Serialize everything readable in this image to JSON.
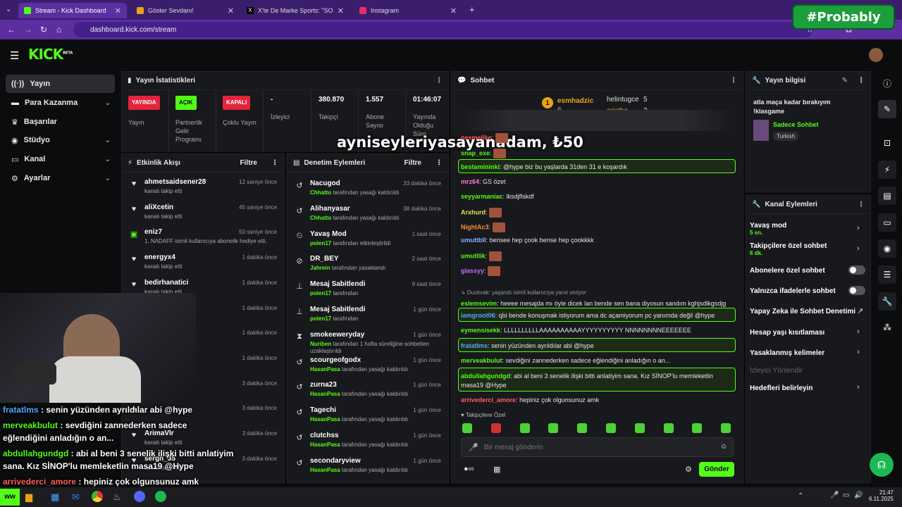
{
  "browser": {
    "tabs": [
      {
        "title": "Stream - Kick Dashboard",
        "color": "#53fc18"
      },
      {
        "title": "Göster Sevdanı!",
        "color": "#e8a317"
      },
      {
        "title": "X'te De Marke Sports: \"SON DA",
        "color": "#000000"
      },
      {
        "title": "Instagram",
        "color": "#e1306c"
      }
    ],
    "url": "dashboard.kick.com/stream",
    "overlay": "#Probably"
  },
  "header": {
    "logo": "KICK",
    "beta": "BETA"
  },
  "sidebar": {
    "items": [
      {
        "label": "Yayın",
        "icon": "stream-icon"
      },
      {
        "label": "Para Kazanma",
        "icon": "money-icon"
      },
      {
        "label": "Başarılar",
        "icon": "trophy-icon"
      },
      {
        "label": "Stüdyo",
        "icon": "studio-icon"
      },
      {
        "label": "Kanal",
        "icon": "channel-icon"
      },
      {
        "label": "Ayarlar",
        "icon": "gear-icon"
      }
    ]
  },
  "stats": {
    "title": "Yayın İstatistikleri",
    "items": [
      {
        "badge": "YAYINDA",
        "label": "Yayın"
      },
      {
        "badge": "AÇIK",
        "label": "Partnerlik Gelir Programı"
      },
      {
        "badge": "KAPALI",
        "label": "Çoklu Yayın"
      },
      {
        "value": "-",
        "label": "İzleyici"
      },
      {
        "value": "380.870",
        "label": "Takipçi"
      },
      {
        "value": "1.557",
        "label": "Abone Sayısı"
      },
      {
        "value": "01:46:07",
        "label": "Yayında Olduğu Süre"
      }
    ]
  },
  "activity": {
    "title": "Etkinlik Akışı",
    "filter": "Filtre",
    "rows": [
      {
        "name": "ahmetsaidsener28",
        "desc": "kanalı takip etti",
        "time": "12 saniye önce"
      },
      {
        "name": "aliXcetin",
        "desc": "kanalı takip etti",
        "time": "45 saniye önce"
      },
      {
        "name": "eniz7",
        "desc": "1, NADAFF isimli kullanıcıya abonelik hediye etti.",
        "time": "50 saniye önce"
      },
      {
        "name": "energyx4",
        "desc": "kanalı takip etti",
        "time": "1 dakika önce"
      },
      {
        "name": "bedirhanatici",
        "desc": "kanalı takip etti",
        "time": "1 dakika önce"
      },
      {
        "time": "1 dakika önce"
      },
      {
        "time": "1 dakika önce"
      },
      {
        "time": "1 dakika önce"
      },
      {
        "time": "3 dakika önce"
      },
      {
        "time": "3 dakika önce"
      },
      {
        "name": "ArimaVlr",
        "desc": "kanalı takip etti",
        "time": "3 dakika önce"
      },
      {
        "name": "sergn_35",
        "desc": "kanalı takip etti",
        "time": "3 dakika önce"
      }
    ]
  },
  "moderation": {
    "title": "Denetim Eylemleri",
    "filter": "Filtre",
    "rows": [
      {
        "name": "Nacugod",
        "by": "Chhatto",
        "desc": "tarafından yasağı kaldırıldı",
        "time": "33 dakika önce"
      },
      {
        "name": "Alihanyasar",
        "by": "Chhatto",
        "desc": "tarafından yasağı kaldırıldı",
        "time": "38 dakika önce"
      },
      {
        "name": "Yavaş Mod",
        "by": "polen17",
        "desc": "tarafından etkinleştirildi",
        "time": "1 saat önce"
      },
      {
        "name": "DR_BEY",
        "by": "Jahrein",
        "desc": "tarafından yasaklandı",
        "time": "2 saat önce"
      },
      {
        "name": "Mesaj Sabitlendi",
        "by": "polen17",
        "desc": "tarafından",
        "time": "9 saat önce"
      },
      {
        "name": "Mesaj Sabitlendi",
        "by": "polen17",
        "desc": "tarafından",
        "time": "1 gün önce"
      },
      {
        "name": "smokeeweryday",
        "by": "Nuriben",
        "desc": "tarafından 1 hafta süreliğine sohbetten uzaklaştırıldı",
        "time": "1 gün önce"
      },
      {
        "name": "scourgeofgodx",
        "by": "HasanPasa",
        "desc": "tarafından yasağı kaldırıldı",
        "time": "1 gün önce"
      },
      {
        "name": "zurna23",
        "by": "HasanPasa",
        "desc": "tarafından yasağı kaldırıldı",
        "time": "1 gün önce"
      },
      {
        "name": "Tagechi",
        "by": "HasanPasa",
        "desc": "tarafından yasağı kaldırıldı",
        "time": "1 gün önce"
      },
      {
        "name": "clutchss",
        "by": "HasanPasa",
        "desc": "tarafından yasağı kaldırıldı",
        "time": "1 gün önce"
      },
      {
        "name": "secondaryview",
        "by": "HasanPasa",
        "desc": "tarafından yasağı kaldırıldı",
        "time": "1 gün önce"
      }
    ]
  },
  "chat": {
    "title": "Sohbet",
    "top": [
      {
        "name": "esmhadzic",
        "count": "6"
      },
      {
        "name": "helintugce",
        "count": "5"
      },
      {
        "name": "aristha",
        "count": "2"
      }
    ],
    "donation": "ayniseyleriyasayanadam, ₺50",
    "messages": [
      {
        "user": "nesmelike",
        "color": "#ff5c5c",
        "text": ""
      },
      {
        "user": "snap_exe",
        "color": "#53fc18",
        "text": ""
      },
      {
        "user": "bestamininki",
        "color": "#53fc18",
        "text": "@hype biz bu yaşlarda 31den 31 e koşardık"
      },
      {
        "user": "mrz64",
        "color": "#ff7ad1",
        "text": "GS özet"
      },
      {
        "user": "seyyarmaniac",
        "color": "#53fc18",
        "text": "lksdjflskdf"
      },
      {
        "user": "Arxhurd",
        "color": "#e8e35a",
        "text": ""
      },
      {
        "user": "NightAc3",
        "color": "#ff8c3a",
        "text": ""
      },
      {
        "user": "umuttbll",
        "color": "#8ab4ff",
        "text": "bensee hep çook bense hep çookkkk"
      },
      {
        "user": "umutllik",
        "color": "#53fc18",
        "text": ""
      },
      {
        "user": "glassyy",
        "color": "#c46bff",
        "text": ""
      },
      {
        "user": "eslemsevim",
        "color": "#53fc18",
        "text": "heeee mesajda mı öyle dicek lan bende sen bana diyosun sandım kghjsdlkgsdjg",
        "reply": "Duckvak: yaşandı isimli kullanıcıya yanıt veriyor"
      },
      {
        "user": "iamgroot06",
        "color": "#53a6ff",
        "text": "qbi bende konuşmak istiyorum ama dc açamiyorum pc yanımda değil @hype"
      },
      {
        "user": "eymensisekk",
        "color": "#53fc18",
        "text": "LLLLLLLLLLAAAAAAAAAAYYYYYYYYYY NNNNNNNNEEEEEEE"
      },
      {
        "user": "fratatlms",
        "color": "#53a6ff",
        "text": "senin yüzünden ayrıldılar abi @hype"
      },
      {
        "user": "merveakbulut",
        "color": "#53fc18",
        "text": "sevdiğini zannederken sadece eğlendiğini anladığın o an..."
      },
      {
        "user": "abdullahgundgd",
        "color": "#53fc18",
        "text": "abi al beni 3 senelik ilişki bitti anlatiyim sana. Kız SİNOP'lu memleketlin masa19 @Hype"
      },
      {
        "user": "arrivederci_amore",
        "color": "#ff5c5c",
        "text": "hepiniz çok olgunsunuz amk"
      }
    ],
    "follower_only": "Takipçilere Özel",
    "placeholder": "Bir mesaj gönderin",
    "send": "Gönder"
  },
  "stream_info": {
    "title": "Yayın bilgisi",
    "stream_title": "atla maça kadar bırakıyım !klasgame",
    "category": "Sadece Sohbet",
    "tag": "Turkish"
  },
  "channel_actions": {
    "title": "Kanal Eylemleri",
    "items": [
      {
        "label": "Yavaş mod",
        "sub": "5 sn."
      },
      {
        "label": "Takipçilere özel sohbet",
        "sub": "6 dk."
      },
      {
        "label": "Abonelere özel sohbet"
      },
      {
        "label": "Yalnızca ifadelerle sohbet"
      },
      {
        "label": "Yapay Zeka ile Sohbet Denetimi"
      },
      {
        "label": "Hesap yaşı kısıtlaması"
      },
      {
        "label": "Yasaklanmış kelimeler"
      },
      {
        "label": "İzleyici Yönlendir"
      },
      {
        "label": "Hedefleri belirleyin"
      }
    ]
  },
  "overlay_chat": [
    {
      "user": "fratatlms",
      "color": "#53a6ff",
      "text": " : senin yüzünden ayrıldılar abi @hype"
    },
    {
      "user": "merveakbulut",
      "color": "#53fc18",
      "text": " : sevdiğini zannederken sadece"
    },
    {
      "user": "",
      "color": "#fff",
      "text": "eğlendiğini anladığın o an..."
    },
    {
      "user": "abdullahgundgd",
      "color": "#53fc18",
      "text": " : abi al beni 3 senelik ilişki bitti anlatiyim"
    },
    {
      "user": "",
      "color": "#fff",
      "text": "sana. Kız SİNOP'lu memleketlin masa19 @Hype"
    },
    {
      "user": "arrivederci_amore",
      "color": "#ff5c5c",
      "text": " : hepiniz çok olgunsunuz amk"
    }
  ],
  "taskbar": {
    "time": "21:47",
    "date": "6.11.2025"
  }
}
